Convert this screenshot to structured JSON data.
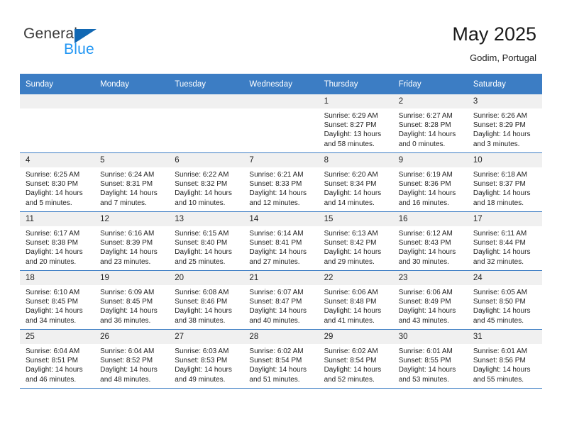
{
  "brand": {
    "name_part1": "General",
    "name_part2": "Blue",
    "triangle_color": "#1268b3",
    "blue_color": "#2196f3"
  },
  "header": {
    "title": "May 2025",
    "subtitle": "Godim, Portugal"
  },
  "colors": {
    "header_row": "#3c7dc4",
    "daynum_bar": "#f0f0f0",
    "grid_line": "#3c7dc4",
    "text": "#222222"
  },
  "weekday_headers": [
    "Sunday",
    "Monday",
    "Tuesday",
    "Wednesday",
    "Thursday",
    "Friday",
    "Saturday"
  ],
  "labels": {
    "sunrise_prefix": "Sunrise:",
    "sunset_prefix": "Sunset:",
    "daylight_prefix": "Daylight:"
  },
  "weeks": [
    [
      {
        "empty": true
      },
      {
        "empty": true
      },
      {
        "empty": true
      },
      {
        "empty": true
      },
      {
        "day": "1",
        "sunrise": "Sunrise: 6:29 AM",
        "sunset": "Sunset: 8:27 PM",
        "daylight_l1": "Daylight: 13 hours",
        "daylight_l2": "and 58 minutes."
      },
      {
        "day": "2",
        "sunrise": "Sunrise: 6:27 AM",
        "sunset": "Sunset: 8:28 PM",
        "daylight_l1": "Daylight: 14 hours",
        "daylight_l2": "and 0 minutes."
      },
      {
        "day": "3",
        "sunrise": "Sunrise: 6:26 AM",
        "sunset": "Sunset: 8:29 PM",
        "daylight_l1": "Daylight: 14 hours",
        "daylight_l2": "and 3 minutes."
      }
    ],
    [
      {
        "day": "4",
        "sunrise": "Sunrise: 6:25 AM",
        "sunset": "Sunset: 8:30 PM",
        "daylight_l1": "Daylight: 14 hours",
        "daylight_l2": "and 5 minutes."
      },
      {
        "day": "5",
        "sunrise": "Sunrise: 6:24 AM",
        "sunset": "Sunset: 8:31 PM",
        "daylight_l1": "Daylight: 14 hours",
        "daylight_l2": "and 7 minutes."
      },
      {
        "day": "6",
        "sunrise": "Sunrise: 6:22 AM",
        "sunset": "Sunset: 8:32 PM",
        "daylight_l1": "Daylight: 14 hours",
        "daylight_l2": "and 10 minutes."
      },
      {
        "day": "7",
        "sunrise": "Sunrise: 6:21 AM",
        "sunset": "Sunset: 8:33 PM",
        "daylight_l1": "Daylight: 14 hours",
        "daylight_l2": "and 12 minutes."
      },
      {
        "day": "8",
        "sunrise": "Sunrise: 6:20 AM",
        "sunset": "Sunset: 8:34 PM",
        "daylight_l1": "Daylight: 14 hours",
        "daylight_l2": "and 14 minutes."
      },
      {
        "day": "9",
        "sunrise": "Sunrise: 6:19 AM",
        "sunset": "Sunset: 8:36 PM",
        "daylight_l1": "Daylight: 14 hours",
        "daylight_l2": "and 16 minutes."
      },
      {
        "day": "10",
        "sunrise": "Sunrise: 6:18 AM",
        "sunset": "Sunset: 8:37 PM",
        "daylight_l1": "Daylight: 14 hours",
        "daylight_l2": "and 18 minutes."
      }
    ],
    [
      {
        "day": "11",
        "sunrise": "Sunrise: 6:17 AM",
        "sunset": "Sunset: 8:38 PM",
        "daylight_l1": "Daylight: 14 hours",
        "daylight_l2": "and 20 minutes."
      },
      {
        "day": "12",
        "sunrise": "Sunrise: 6:16 AM",
        "sunset": "Sunset: 8:39 PM",
        "daylight_l1": "Daylight: 14 hours",
        "daylight_l2": "and 23 minutes."
      },
      {
        "day": "13",
        "sunrise": "Sunrise: 6:15 AM",
        "sunset": "Sunset: 8:40 PM",
        "daylight_l1": "Daylight: 14 hours",
        "daylight_l2": "and 25 minutes."
      },
      {
        "day": "14",
        "sunrise": "Sunrise: 6:14 AM",
        "sunset": "Sunset: 8:41 PM",
        "daylight_l1": "Daylight: 14 hours",
        "daylight_l2": "and 27 minutes."
      },
      {
        "day": "15",
        "sunrise": "Sunrise: 6:13 AM",
        "sunset": "Sunset: 8:42 PM",
        "daylight_l1": "Daylight: 14 hours",
        "daylight_l2": "and 29 minutes."
      },
      {
        "day": "16",
        "sunrise": "Sunrise: 6:12 AM",
        "sunset": "Sunset: 8:43 PM",
        "daylight_l1": "Daylight: 14 hours",
        "daylight_l2": "and 30 minutes."
      },
      {
        "day": "17",
        "sunrise": "Sunrise: 6:11 AM",
        "sunset": "Sunset: 8:44 PM",
        "daylight_l1": "Daylight: 14 hours",
        "daylight_l2": "and 32 minutes."
      }
    ],
    [
      {
        "day": "18",
        "sunrise": "Sunrise: 6:10 AM",
        "sunset": "Sunset: 8:45 PM",
        "daylight_l1": "Daylight: 14 hours",
        "daylight_l2": "and 34 minutes."
      },
      {
        "day": "19",
        "sunrise": "Sunrise: 6:09 AM",
        "sunset": "Sunset: 8:45 PM",
        "daylight_l1": "Daylight: 14 hours",
        "daylight_l2": "and 36 minutes."
      },
      {
        "day": "20",
        "sunrise": "Sunrise: 6:08 AM",
        "sunset": "Sunset: 8:46 PM",
        "daylight_l1": "Daylight: 14 hours",
        "daylight_l2": "and 38 minutes."
      },
      {
        "day": "21",
        "sunrise": "Sunrise: 6:07 AM",
        "sunset": "Sunset: 8:47 PM",
        "daylight_l1": "Daylight: 14 hours",
        "daylight_l2": "and 40 minutes."
      },
      {
        "day": "22",
        "sunrise": "Sunrise: 6:06 AM",
        "sunset": "Sunset: 8:48 PM",
        "daylight_l1": "Daylight: 14 hours",
        "daylight_l2": "and 41 minutes."
      },
      {
        "day": "23",
        "sunrise": "Sunrise: 6:06 AM",
        "sunset": "Sunset: 8:49 PM",
        "daylight_l1": "Daylight: 14 hours",
        "daylight_l2": "and 43 minutes."
      },
      {
        "day": "24",
        "sunrise": "Sunrise: 6:05 AM",
        "sunset": "Sunset: 8:50 PM",
        "daylight_l1": "Daylight: 14 hours",
        "daylight_l2": "and 45 minutes."
      }
    ],
    [
      {
        "day": "25",
        "sunrise": "Sunrise: 6:04 AM",
        "sunset": "Sunset: 8:51 PM",
        "daylight_l1": "Daylight: 14 hours",
        "daylight_l2": "and 46 minutes."
      },
      {
        "day": "26",
        "sunrise": "Sunrise: 6:04 AM",
        "sunset": "Sunset: 8:52 PM",
        "daylight_l1": "Daylight: 14 hours",
        "daylight_l2": "and 48 minutes."
      },
      {
        "day": "27",
        "sunrise": "Sunrise: 6:03 AM",
        "sunset": "Sunset: 8:53 PM",
        "daylight_l1": "Daylight: 14 hours",
        "daylight_l2": "and 49 minutes."
      },
      {
        "day": "28",
        "sunrise": "Sunrise: 6:02 AM",
        "sunset": "Sunset: 8:54 PM",
        "daylight_l1": "Daylight: 14 hours",
        "daylight_l2": "and 51 minutes."
      },
      {
        "day": "29",
        "sunrise": "Sunrise: 6:02 AM",
        "sunset": "Sunset: 8:54 PM",
        "daylight_l1": "Daylight: 14 hours",
        "daylight_l2": "and 52 minutes."
      },
      {
        "day": "30",
        "sunrise": "Sunrise: 6:01 AM",
        "sunset": "Sunset: 8:55 PM",
        "daylight_l1": "Daylight: 14 hours",
        "daylight_l2": "and 53 minutes."
      },
      {
        "day": "31",
        "sunrise": "Sunrise: 6:01 AM",
        "sunset": "Sunset: 8:56 PM",
        "daylight_l1": "Daylight: 14 hours",
        "daylight_l2": "and 55 minutes."
      }
    ]
  ]
}
